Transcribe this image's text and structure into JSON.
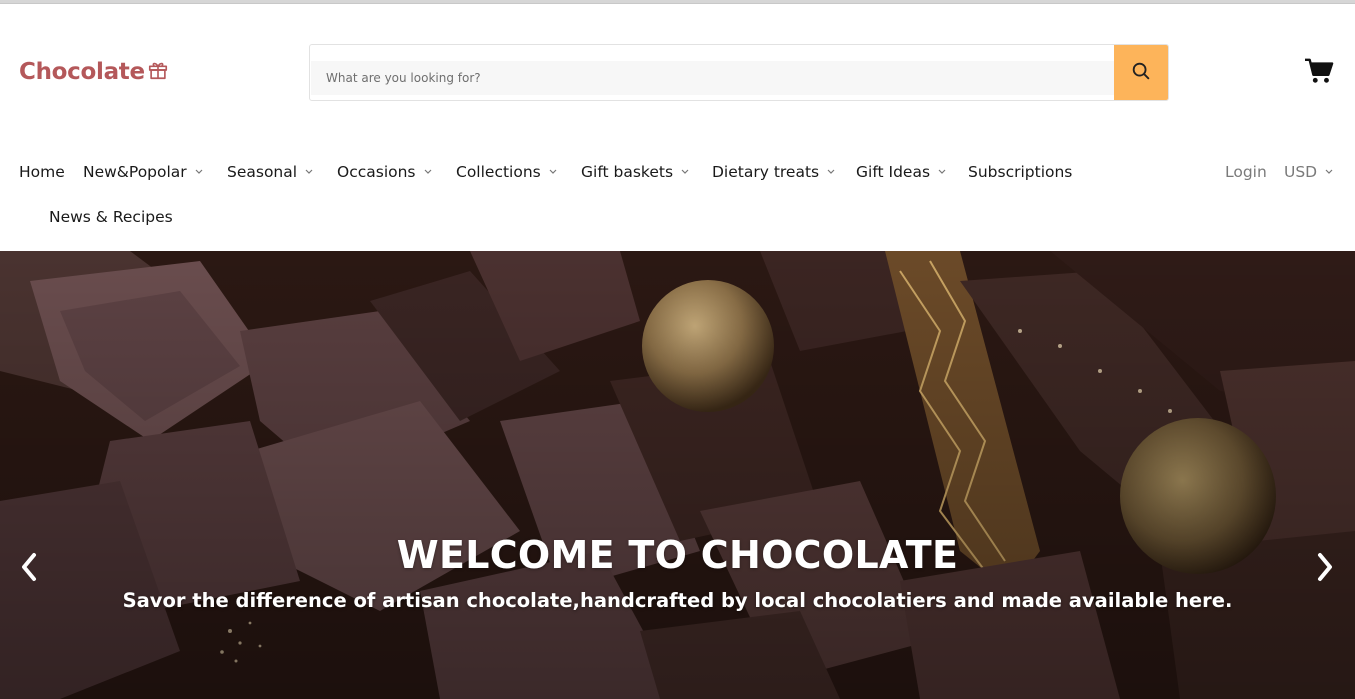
{
  "header": {
    "logo_text": "Chocolate",
    "logo_icon": "gift-icon",
    "brand_color": "#b4585a",
    "search": {
      "placeholder": "What are you looking for?",
      "value": "",
      "button_icon": "search-icon",
      "button_color": "#fdb45a"
    },
    "cart_icon": "cart-icon"
  },
  "nav": {
    "items": [
      {
        "label": "Home",
        "has_dropdown": false
      },
      {
        "label": "New&Popolar",
        "has_dropdown": true
      },
      {
        "label": "Seasonal",
        "has_dropdown": true
      },
      {
        "label": "Occasions",
        "has_dropdown": true
      },
      {
        "label": "Collections",
        "has_dropdown": true
      },
      {
        "label": "Gift baskets",
        "has_dropdown": true
      },
      {
        "label": "Dietary treats",
        "has_dropdown": true
      },
      {
        "label": "Gift Ideas",
        "has_dropdown": true
      },
      {
        "label": "Subscriptions",
        "has_dropdown": false
      },
      {
        "label": "News & Recipes",
        "has_dropdown": false
      }
    ],
    "login_label": "Login",
    "currency_label": "USD"
  },
  "hero": {
    "title": "WELCOME TO CHOCOLATE",
    "subtitle": "Savor the difference of artisan chocolate,handcrafted by local chocolatiers and made available here.",
    "prev_icon": "chevron-left-icon",
    "next_icon": "chevron-right-icon"
  }
}
